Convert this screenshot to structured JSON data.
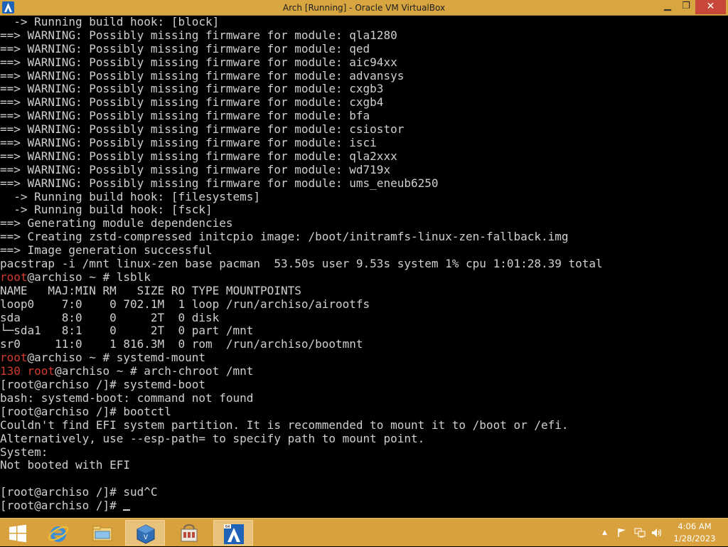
{
  "window": {
    "title": "Arch [Running] - Oracle VM VirtualBox",
    "min_label": "▁",
    "max_label": "❐",
    "close_label": "✕"
  },
  "console": {
    "lines": [
      {
        "pre": "",
        "red": "",
        "text": "  -> Running build hook: [block]"
      },
      {
        "pre": "",
        "red": "",
        "text": "==> WARNING: Possibly missing firmware for module: qla1280"
      },
      {
        "pre": "",
        "red": "",
        "text": "==> WARNING: Possibly missing firmware for module: qed"
      },
      {
        "pre": "",
        "red": "",
        "text": "==> WARNING: Possibly missing firmware for module: aic94xx"
      },
      {
        "pre": "",
        "red": "",
        "text": "==> WARNING: Possibly missing firmware for module: advansys"
      },
      {
        "pre": "",
        "red": "",
        "text": "==> WARNING: Possibly missing firmware for module: cxgb3"
      },
      {
        "pre": "",
        "red": "",
        "text": "==> WARNING: Possibly missing firmware for module: cxgb4"
      },
      {
        "pre": "",
        "red": "",
        "text": "==> WARNING: Possibly missing firmware for module: bfa"
      },
      {
        "pre": "",
        "red": "",
        "text": "==> WARNING: Possibly missing firmware for module: csiostor"
      },
      {
        "pre": "",
        "red": "",
        "text": "==> WARNING: Possibly missing firmware for module: isci"
      },
      {
        "pre": "",
        "red": "",
        "text": "==> WARNING: Possibly missing firmware for module: qla2xxx"
      },
      {
        "pre": "",
        "red": "",
        "text": "==> WARNING: Possibly missing firmware for module: wd719x"
      },
      {
        "pre": "",
        "red": "",
        "text": "==> WARNING: Possibly missing firmware for module: ums_eneub6250"
      },
      {
        "pre": "",
        "red": "",
        "text": "  -> Running build hook: [filesystems]"
      },
      {
        "pre": "",
        "red": "",
        "text": "  -> Running build hook: [fsck]"
      },
      {
        "pre": "",
        "red": "",
        "text": "==> Generating module dependencies"
      },
      {
        "pre": "",
        "red": "",
        "text": "==> Creating zstd-compressed initcpio image: /boot/initramfs-linux-zen-fallback.img"
      },
      {
        "pre": "",
        "red": "",
        "text": "==> Image generation successful"
      },
      {
        "pre": "",
        "red": "",
        "text": "pacstrap -i /mnt linux-zen base pacman  53.50s user 9.53s system 1% cpu 1:01:28.39 total"
      },
      {
        "pre": "",
        "red": "root",
        "text": "@archiso ~ # lsblk"
      },
      {
        "pre": "",
        "red": "",
        "text": "NAME   MAJ:MIN RM   SIZE RO TYPE MOUNTPOINTS"
      },
      {
        "pre": "",
        "red": "",
        "text": "loop0    7:0    0 702.1M  1 loop /run/archiso/airootfs"
      },
      {
        "pre": "",
        "red": "",
        "text": "sda      8:0    0     2T  0 disk"
      },
      {
        "pre": "",
        "red": "",
        "text": "└─sda1   8:1    0     2T  0 part /mnt"
      },
      {
        "pre": "",
        "red": "",
        "text": "sr0     11:0    1 816.3M  0 rom  /run/archiso/bootmnt"
      },
      {
        "pre": "",
        "red": "root",
        "text": "@archiso ~ # systemd-mount"
      },
      {
        "pre": "130 ",
        "red": "root",
        "text": "@archiso ~ # arch-chroot /mnt"
      },
      {
        "pre": "",
        "red": "",
        "text": "[root@archiso /]# systemd-boot"
      },
      {
        "pre": "",
        "red": "",
        "text": "bash: systemd-boot: command not found"
      },
      {
        "pre": "",
        "red": "",
        "text": "[root@archiso /]# bootctl"
      },
      {
        "pre": "",
        "red": "",
        "text": "Couldn't find EFI system partition. It is recommended to mount it to /boot or /efi."
      },
      {
        "pre": "",
        "red": "",
        "text": "Alternatively, use --esp-path= to specify path to mount point."
      },
      {
        "pre": "",
        "red": "",
        "text": "System:"
      },
      {
        "pre": "",
        "red": "",
        "text": "Not booted with EFI"
      },
      {
        "pre": "",
        "red": "",
        "text": ""
      },
      {
        "pre": "",
        "red": "",
        "text": "[root@archiso /]# sud^C"
      },
      {
        "pre": "",
        "red": "",
        "text": "[root@archiso /]# "
      }
    ],
    "prompt_color": "#d23a2e",
    "text_color": "#cfcfcf"
  },
  "taskbar": {
    "apps": [
      {
        "name": "start-button",
        "icon": "windows-logo-icon"
      },
      {
        "name": "taskbar-internet-explorer",
        "icon": "internet-explorer-icon"
      },
      {
        "name": "taskbar-file-explorer",
        "icon": "folder-icon"
      },
      {
        "name": "taskbar-virtualbox-manager",
        "icon": "virtualbox-icon"
      },
      {
        "name": "taskbar-store",
        "icon": "store-icon"
      },
      {
        "name": "taskbar-arch-vm",
        "icon": "arch-linux-icon"
      }
    ],
    "clock_time": "4:06 AM",
    "clock_date": "1/28/2023",
    "tray_chevron": "▲",
    "accent": "#d8a13d"
  }
}
